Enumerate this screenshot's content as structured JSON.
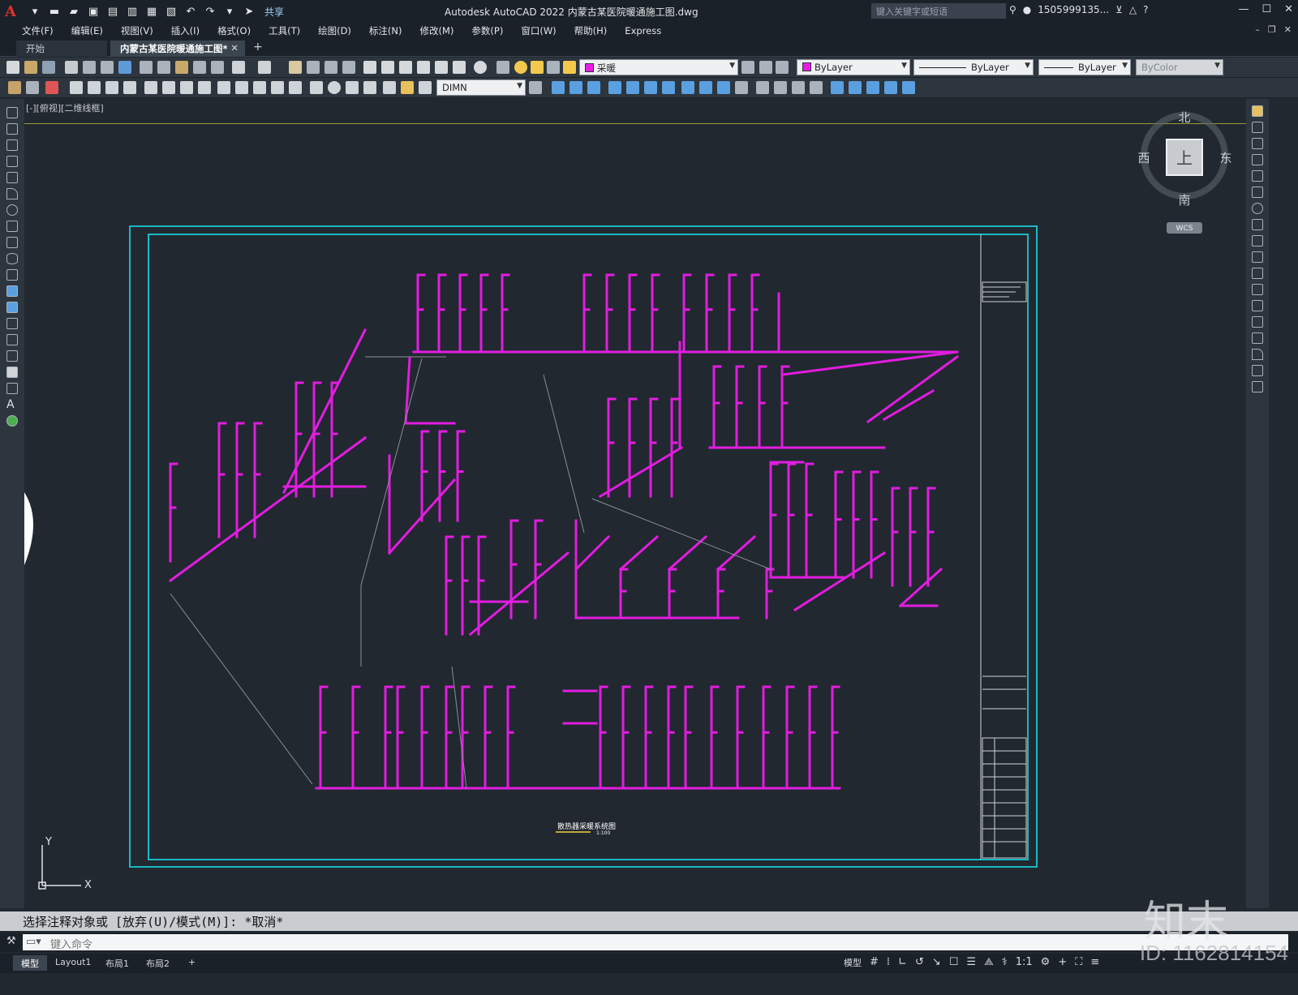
{
  "titlebar": {
    "app_title": "Autodesk AutoCAD 2022    内蒙古某医院暖通施工图.dwg",
    "share_label": "共享",
    "search_placeholder": "键入关键字或短语",
    "user": "1505999135...",
    "logo_letter": "A"
  },
  "menu": [
    "文件(F)",
    "编辑(E)",
    "视图(V)",
    "插入(I)",
    "格式(O)",
    "工具(T)",
    "绘图(D)",
    "标注(N)",
    "修改(M)",
    "参数(P)",
    "窗口(W)",
    "帮助(H)",
    "Express"
  ],
  "tabs": {
    "start": "开始",
    "active": "内蒙古某医院暖通施工图*",
    "plus": "+"
  },
  "layer_toolbar": {
    "layer_name": "采暖",
    "color": "ByLayer",
    "linetype": "ByLayer",
    "lineweight": "ByLayer",
    "plotstyle": "ByColor",
    "dimstyle": "DIMN"
  },
  "viewport": {
    "label": "[-][俯视][二维线框]",
    "drawing_title": "散热器采暖系统图",
    "drawing_scale": "1:100",
    "north": "北",
    "south": "南",
    "east": "东",
    "west": "西",
    "cube_face": "上",
    "wcs": "WCS",
    "ucs_x": "X",
    "ucs_y": "Y"
  },
  "command": {
    "history": "选择注释对象或 [放弃(U)/模式(M)]: *取消*",
    "placeholder": "键入命令"
  },
  "status": {
    "tabs": [
      "模型",
      "Layout1",
      "布局1",
      "布局2"
    ],
    "model_label": "模型",
    "scale": "1:1"
  },
  "overlay": {
    "brand": "知末",
    "id_text": "ID: 1162814154"
  },
  "colors": {
    "pipe": "#e21ce0",
    "frame": "#19b8c4",
    "background": "#212830"
  }
}
